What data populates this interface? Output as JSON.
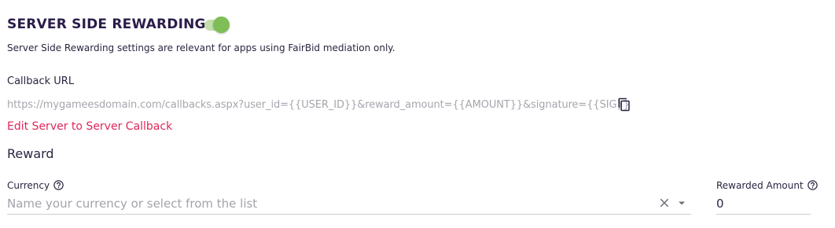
{
  "section": {
    "title": "SERVER SIDE REWARDING",
    "toggle_on": true,
    "description": "Server Side Rewarding settings are relevant for apps using FairBid mediation only."
  },
  "callback": {
    "label": "Callback URL",
    "url": "https://mygameesdomain.com/callbacks.aspx?user_id={{USER_ID}}&reward_amount={{AMOUNT}}&signature={{SIG}}",
    "edit_link": "Edit Server to Server Callback"
  },
  "reward": {
    "heading": "Reward",
    "currency": {
      "label": "Currency",
      "placeholder": "Name your currency or select from the list",
      "value": ""
    },
    "amount": {
      "label": "Rewarded Amount",
      "value": "0"
    }
  },
  "icons": {
    "toggle": "toggle-switch",
    "copy": "copy-icon",
    "help": "help-circle-icon",
    "clear": "close-icon",
    "dropdown": "caret-down-icon"
  },
  "colors": {
    "title": "#2b1d4a",
    "toggle_track": "#c2deaa",
    "toggle_knob": "#7fbe57",
    "link": "#e0275a",
    "muted_text": "#a7a5ad"
  }
}
